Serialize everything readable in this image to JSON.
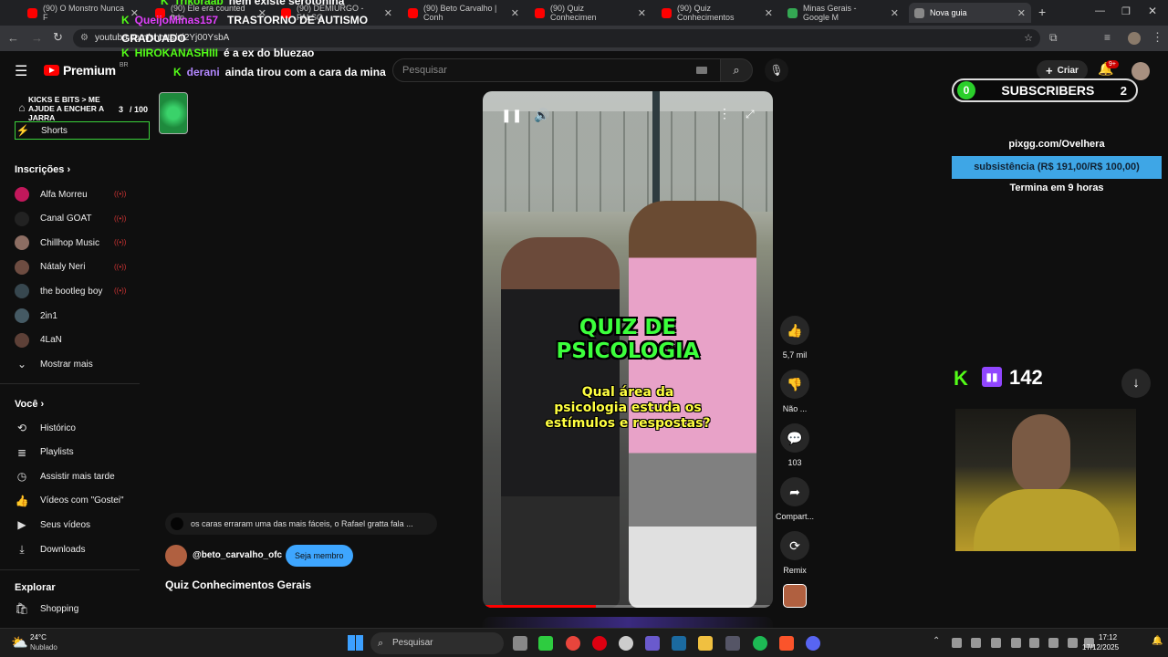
{
  "tabs": [
    {
      "title": "(90) O Monstro Nunca F",
      "color": "#ff0000"
    },
    {
      "title": "(90) Ele era counted ftdo",
      "color": "#ff0000"
    },
    {
      "title": "(90) DEMIURGO - FALSO",
      "color": "#ff0000"
    },
    {
      "title": "(90) Beto Carvalho | Conh",
      "color": "#ff0000"
    },
    {
      "title": "(90) Quiz Conhecimen",
      "color": "#ff0000"
    },
    {
      "title": "(90) Quiz Conhecimentos",
      "color": "#ff0000"
    },
    {
      "title": "Minas Gerais - Google M",
      "color": "#34a853"
    },
    {
      "title": "Nova guia",
      "color": "#888888"
    }
  ],
  "address": {
    "url": "youtube.com/shorts/ni2Yj00YsbA"
  },
  "chat": [
    {
      "user": "Trikoraab",
      "text": "nem existe serotonina",
      "color": "#53fc18"
    },
    {
      "user": "QueijoMinas157",
      "text": "TRASTORNO DE AUTISMO GRADUADO",
      "color": "#e040fb"
    },
    {
      "user": "HIROKANASHIII",
      "text": "é a ex do bluezao",
      "color": "#53fc18"
    },
    {
      "user": "derani",
      "text": "ainda tirou com a cara da mina",
      "color": "#b388ff"
    }
  ],
  "youtube": {
    "logo": "Premium",
    "logo_region": "BR",
    "search_placeholder": "Pesquisar",
    "create_label": "Criar",
    "notif_count": "9+"
  },
  "overlay_goal": {
    "title": "KICKS E BITS > ME AJUDE A ENCHER A JARRA",
    "current": "3",
    "total": "/ 100"
  },
  "sidebar": {
    "shorts": "Shorts",
    "subs_heading": "Inscrições",
    "channels": [
      {
        "name": "Alfa Morreu",
        "color": "#c2185b"
      },
      {
        "name": "Canal GOAT",
        "color": "#222222"
      },
      {
        "name": "Chillhop Music",
        "color": "#8d6e63"
      },
      {
        "name": "Nátaly Neri",
        "color": "#6d4c41"
      },
      {
        "name": "the bootleg boy",
        "color": "#37474f"
      },
      {
        "name": "2in1",
        "color": "#455a64"
      },
      {
        "name": "4LaN",
        "color": "#5d4037"
      }
    ],
    "show_more": "Mostrar mais",
    "you_heading": "Você",
    "you_items": [
      "Histórico",
      "Playlists",
      "Assistir mais tarde",
      "Vídeos com \"Gostei\"",
      "Seus vídeos",
      "Downloads"
    ],
    "explore_heading": "Explorar",
    "explore_items": [
      "Shopping"
    ]
  },
  "short": {
    "title_line1": "QUIZ DE",
    "title_line2": "PSICOLOGIA",
    "question_line1": "Qual área da",
    "question_line2": "psicologia estuda os",
    "question_line3": "estímulos e respostas?",
    "progress": 0.39,
    "comment_preview": "os caras erraram uma das mais fáceis, o Rafael gratta fala ...",
    "channel": "@beto_carvalho_ofc",
    "member_button": "Seja membro",
    "video_title": "Quiz Conhecimentos Gerais",
    "likes": "5,7 mil",
    "dislike_label": "Não ...",
    "comments": "103",
    "share_label": "Compart...",
    "remix_label": "Remix"
  },
  "stream_overlay": {
    "subs_left": "0",
    "subs_label": "SUBSCRIBERS",
    "subs_right": "2",
    "pix_url": "pixgg.com/Ovelhera",
    "pix_bar": "subsistência (R$ 191,00/R$ 100,00)",
    "pix_ends": "Termina em 9 horas",
    "kick_count": "142"
  },
  "taskbar": {
    "weather_temp": "24°C",
    "weather_desc": "Nublado",
    "search": "Pesquisar",
    "time": "17:12",
    "date": "17/12/2025"
  }
}
